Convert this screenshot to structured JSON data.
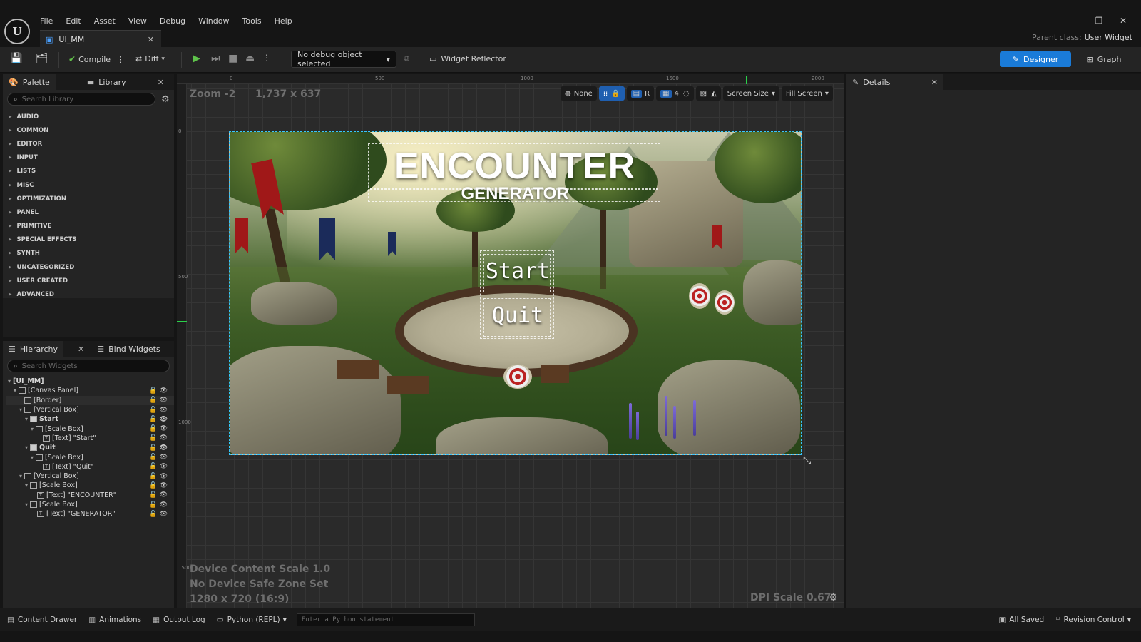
{
  "menu": [
    "File",
    "Edit",
    "Asset",
    "View",
    "Debug",
    "Window",
    "Tools",
    "Help"
  ],
  "doc_tab": {
    "label": "UI_MM"
  },
  "parent_class": {
    "label": "Parent class:",
    "value": "User Widget"
  },
  "toolbar": {
    "compile": "Compile",
    "diff": "Diff",
    "debug_select": "No debug object selected",
    "widget_reflector": "Widget Reflector",
    "designer": "Designer",
    "graph": "Graph"
  },
  "palette": {
    "tab_palette": "Palette",
    "tab_library": "Library",
    "search_placeholder": "Search Library",
    "categories": [
      "AUDIO",
      "COMMON",
      "EDITOR",
      "INPUT",
      "LISTS",
      "MISC",
      "OPTIMIZATION",
      "PANEL",
      "PRIMITIVE",
      "SPECIAL EFFECTS",
      "SYNTH",
      "UNCATEGORIZED",
      "USER CREATED",
      "ADVANCED"
    ]
  },
  "hierarchy": {
    "tab_hierarchy": "Hierarchy",
    "tab_bind": "Bind Widgets",
    "search_placeholder": "Search Widgets",
    "root": "[UI_MM]",
    "rows": [
      {
        "label": "[Canvas Panel]"
      },
      {
        "label": "[Border]"
      },
      {
        "label": "[Vertical Box]"
      },
      {
        "label": "Start"
      },
      {
        "label": "[Scale Box]"
      },
      {
        "label": "[Text] \"Start\""
      },
      {
        "label": "Quit"
      },
      {
        "label": "[Scale Box]"
      },
      {
        "label": "[Text] \"Quit\""
      },
      {
        "label": "[Vertical Box]"
      },
      {
        "label": "[Scale Box]"
      },
      {
        "label": "[Text] \"ENCOUNTER\""
      },
      {
        "label": "[Scale Box]"
      },
      {
        "label": "[Text] \"GENERATOR\""
      }
    ]
  },
  "canvas": {
    "zoom": "Zoom -2",
    "resolution": "1,737 x 637",
    "ruler_top": [
      "0",
      "500",
      "1000",
      "1500",
      "2000"
    ],
    "ruler_left": [
      "0",
      "500",
      "1000",
      "1500"
    ],
    "tools": {
      "none": "None",
      "r": "R",
      "grid": "4",
      "screen_size": "Screen Size",
      "fill_screen": "Fill Screen"
    },
    "device_scale": "Device Content Scale 1.0",
    "safe_zone": "No Device Safe Zone Set",
    "screen_res": "1280 x 720 (16:9)",
    "dpi": "DPI Scale 0.67"
  },
  "preview": {
    "title": "ENCOUNTER",
    "subtitle": "GENERATOR",
    "start": "Start",
    "quit": "Quit"
  },
  "details": {
    "tab": "Details"
  },
  "statusbar": {
    "content_drawer": "Content Drawer",
    "animations": "Animations",
    "output_log": "Output Log",
    "python": "Python (REPL)",
    "python_placeholder": "Enter a Python statement",
    "all_saved": "All Saved",
    "revision_control": "Revision Control"
  },
  "colors": {
    "accent": "#1a7bd8",
    "selection": "#38c3ff",
    "banner_red": "#a01818"
  }
}
